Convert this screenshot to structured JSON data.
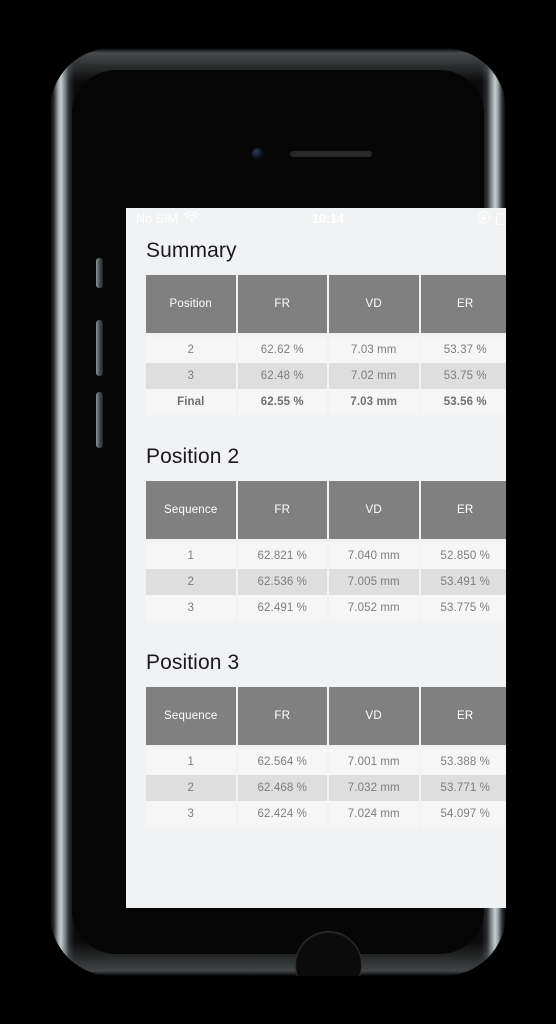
{
  "status_bar": {
    "carrier": "No SIM",
    "wifi_icon": "wifi-icon",
    "time": "10:14",
    "rotation_lock_icon": "rotation-lock-icon",
    "battery_icon": "battery-charging-icon",
    "battery_color": "#4cd766"
  },
  "theme": {
    "screen_background": "#f1f2f3",
    "header_cell": "#808080",
    "row_light": "#f6f6f7",
    "row_dark": "#dededf",
    "text_muted": "#7b7d7f",
    "title_color": "#1b1b1d"
  },
  "sections": [
    {
      "title": "Summary",
      "columns": [
        "Position",
        "FR",
        "VD",
        "ER"
      ],
      "rows": [
        {
          "cells": [
            "2",
            "62.62 %",
            "7.03 mm",
            "53.37 %"
          ],
          "emphasis": false
        },
        {
          "cells": [
            "3",
            "62.48 %",
            "7.02 mm",
            "53.75 %"
          ],
          "emphasis": false
        },
        {
          "cells": [
            "Final",
            "62.55 %",
            "7.03 mm",
            "53.56 %"
          ],
          "emphasis": true
        }
      ]
    },
    {
      "title": "Position 2",
      "columns": [
        "Sequence",
        "FR",
        "VD",
        "ER"
      ],
      "rows": [
        {
          "cells": [
            "1",
            "62.821 %",
            "7.040 mm",
            "52.850 %"
          ],
          "emphasis": false
        },
        {
          "cells": [
            "2",
            "62.536 %",
            "7.005 mm",
            "53.491 %"
          ],
          "emphasis": false
        },
        {
          "cells": [
            "3",
            "62.491 %",
            "7.052 mm",
            "53.775 %"
          ],
          "emphasis": false
        }
      ]
    },
    {
      "title": "Position 3",
      "columns": [
        "Sequence",
        "FR",
        "VD",
        "ER"
      ],
      "rows": [
        {
          "cells": [
            "1",
            "62.564 %",
            "7.001 mm",
            "53.388 %"
          ],
          "emphasis": false
        },
        {
          "cells": [
            "2",
            "62.468 %",
            "7.032 mm",
            "53.771 %"
          ],
          "emphasis": false
        },
        {
          "cells": [
            "3",
            "62.424 %",
            "7.024 mm",
            "54.097 %"
          ],
          "emphasis": false
        }
      ]
    }
  ]
}
